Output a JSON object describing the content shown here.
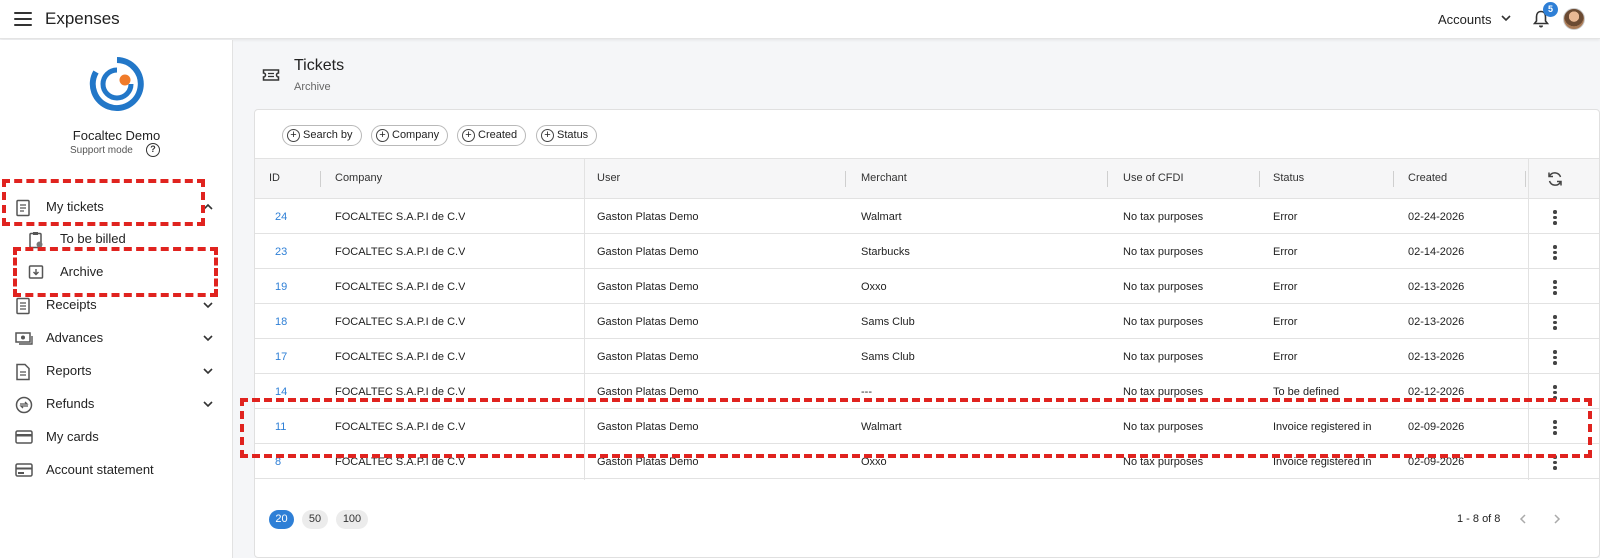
{
  "app": {
    "title": "Expenses"
  },
  "topbar": {
    "accounts_label": "Accounts",
    "notifications_count": "5"
  },
  "sidebar": {
    "org_name": "Focaltec Demo",
    "support_mode": "Support mode",
    "items": [
      {
        "label": "My tickets",
        "icon": "ticket-icon",
        "expanded": true
      },
      {
        "label": "To be billed",
        "icon": "clipboard-icon"
      },
      {
        "label": "Archive",
        "icon": "archive-icon"
      },
      {
        "label": "Receipts",
        "icon": "receipt-icon"
      },
      {
        "label": "Advances",
        "icon": "cash-icon"
      },
      {
        "label": "Reports",
        "icon": "report-icon"
      },
      {
        "label": "Refunds",
        "icon": "refund-icon"
      },
      {
        "label": "My cards",
        "icon": "card-icon"
      },
      {
        "label": "Account statement",
        "icon": "statement-icon"
      }
    ]
  },
  "page": {
    "title": "Tickets",
    "subtitle": "Archive"
  },
  "filters": [
    "Search by",
    "Company",
    "Created",
    "Status"
  ],
  "table": {
    "columns": [
      "ID",
      "Company",
      "User",
      "Merchant",
      "Use of CFDI",
      "Status",
      "Created"
    ],
    "rows": [
      {
        "id": "24",
        "company": "FOCALTEC S.A.P.I de C.V",
        "user": "Gaston Platas Demo",
        "merchant": "Walmart",
        "cfdi": "No tax purposes",
        "status": "Error",
        "created": "02-24-2026"
      },
      {
        "id": "23",
        "company": "FOCALTEC S.A.P.I de C.V",
        "user": "Gaston Platas Demo",
        "merchant": "Starbucks",
        "cfdi": "No tax purposes",
        "status": "Error",
        "created": "02-14-2026"
      },
      {
        "id": "19",
        "company": "FOCALTEC S.A.P.I de C.V",
        "user": "Gaston Platas Demo",
        "merchant": "Oxxo",
        "cfdi": "No tax purposes",
        "status": "Error",
        "created": "02-13-2026"
      },
      {
        "id": "18",
        "company": "FOCALTEC S.A.P.I de C.V",
        "user": "Gaston Platas Demo",
        "merchant": "Sams Club",
        "cfdi": "No tax purposes",
        "status": "Error",
        "created": "02-13-2026"
      },
      {
        "id": "17",
        "company": "FOCALTEC S.A.P.I de C.V",
        "user": "Gaston Platas Demo",
        "merchant": "Sams Club",
        "cfdi": "No tax purposes",
        "status": "Error",
        "created": "02-13-2026"
      },
      {
        "id": "14",
        "company": "FOCALTEC S.A.P.I de C.V",
        "user": "Gaston Platas Demo",
        "merchant": "---",
        "cfdi": "No tax purposes",
        "status": "To be defined",
        "created": "02-12-2026"
      },
      {
        "id": "11",
        "company": "FOCALTEC S.A.P.I de C.V",
        "user": "Gaston Platas Demo",
        "merchant": "Walmart",
        "cfdi": "No tax purposes",
        "status": "Invoice registered in",
        "created": "02-09-2026"
      },
      {
        "id": "8",
        "company": "FOCALTEC S.A.P.I de C.V",
        "user": "Gaston Platas Demo",
        "merchant": "Oxxo",
        "cfdi": "No tax purposes",
        "status": "Invoice registered in",
        "created": "02-09-2026"
      }
    ]
  },
  "pagination": {
    "sizes": [
      "20",
      "50",
      "100"
    ],
    "selected": "20",
    "range": "1 - 8 of 8"
  },
  "colors": {
    "accent": "#2e7fd6",
    "highlight": "#e0231f"
  }
}
